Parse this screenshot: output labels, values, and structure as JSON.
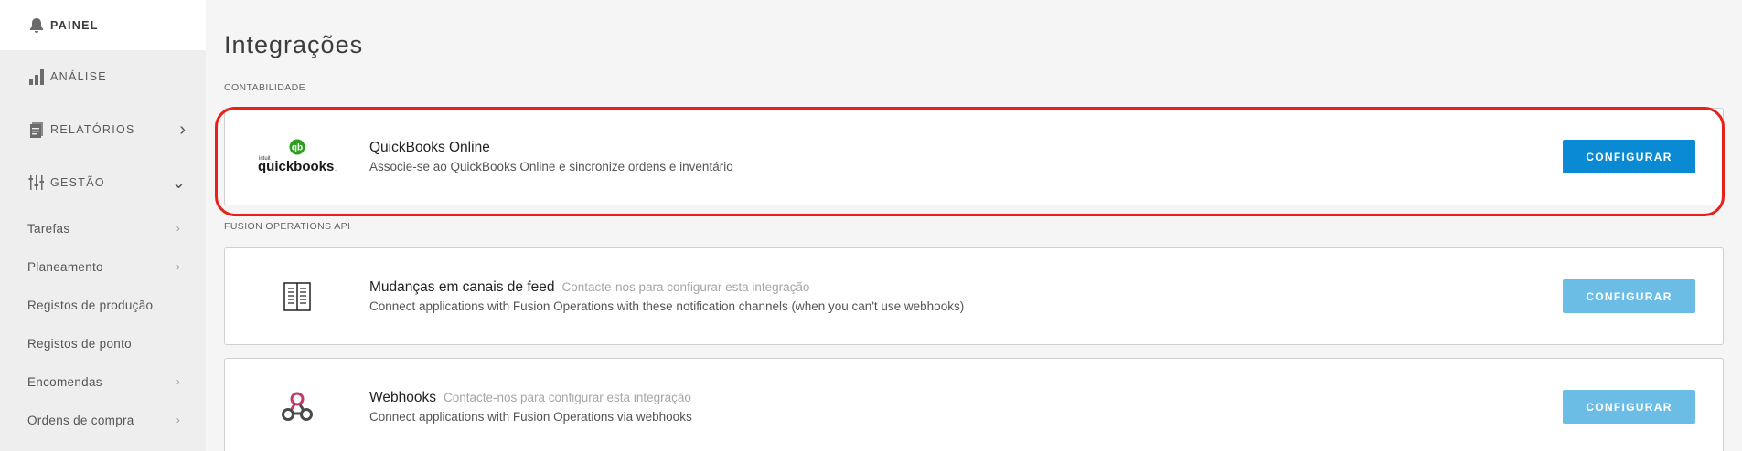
{
  "sidebar": {
    "top": {
      "label": "PAINEL",
      "icon": "bell-icon"
    },
    "sections": [
      {
        "label": "ANÁLISE",
        "icon": "bar-chart-icon",
        "chevron": ""
      },
      {
        "label": "RELATÓRIOS",
        "icon": "document-icon",
        "chevron": "›"
      },
      {
        "label": "GESTÃO",
        "icon": "sliders-icon",
        "chevron": "⌄"
      }
    ],
    "items": [
      {
        "label": "Tarefas",
        "chevron": "›"
      },
      {
        "label": "Planeamento",
        "chevron": "›"
      },
      {
        "label": "Registos de produção",
        "chevron": ""
      },
      {
        "label": "Registos de ponto",
        "chevron": ""
      },
      {
        "label": "Encomendas",
        "chevron": "›"
      },
      {
        "label": "Ordens de compra",
        "chevron": "›"
      }
    ]
  },
  "main": {
    "title": "Integrações",
    "sections": [
      {
        "label": "CONTABILIDADE",
        "cards": [
          {
            "title": "QuickBooks Online",
            "note": "",
            "description": "Associe-se ao QuickBooks Online e sincronize ordens e inventário",
            "button": "CONFIGURAR",
            "logo": {
              "small": "intuit",
              "main": "quickbooks",
              "badge": "qb"
            }
          }
        ]
      },
      {
        "label": "FUSION OPERATIONS API",
        "cards": [
          {
            "title": "Mudanças em canais de feed",
            "note": "Contacte-nos para configurar esta integração",
            "description": "Connect applications with Fusion Operations with these notification channels (when you can't use webhooks)",
            "button": "CONFIGURAR",
            "icon": "feed-book-icon"
          },
          {
            "title": "Webhooks",
            "note": "Contacte-nos para configurar esta integração",
            "description": "Connect applications with Fusion Operations via webhooks",
            "button": "CONFIGURAR",
            "icon": "webhook-icon"
          }
        ]
      }
    ]
  },
  "colors": {
    "accent": "#0a8ad2",
    "accent_disabled": "#6cbde6",
    "highlight": "#e8201a",
    "quickbooks_green": "#2ca01c"
  }
}
